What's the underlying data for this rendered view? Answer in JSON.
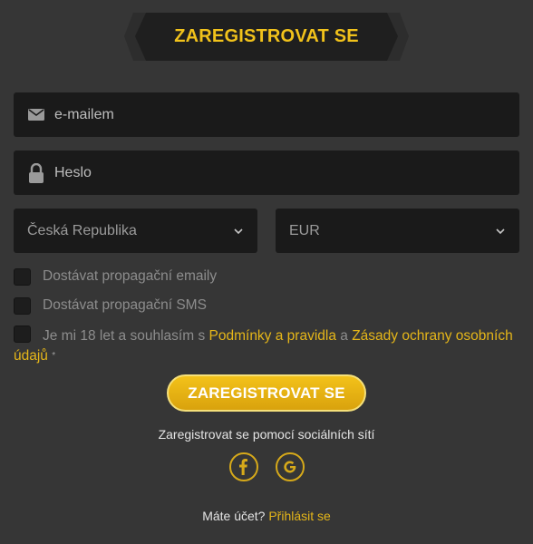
{
  "header": {
    "title": "ZAREGISTROVAT SE"
  },
  "form": {
    "email": {
      "placeholder": "e-mailem",
      "icon": "envelope-icon"
    },
    "password": {
      "placeholder": "Heslo",
      "icon": "lock-icon"
    },
    "country": {
      "value": "Česká Republika",
      "icon": "chevron-down-icon"
    },
    "currency": {
      "value": "EUR",
      "icon": "chevron-down-icon"
    }
  },
  "checkboxes": {
    "promo_emails": "Dostávat propagační emaily",
    "promo_sms": "Dostávat propagační SMS",
    "terms_prefix": "Je mi 18 let a souhlasím s",
    "terms_link": "Podmínky a pravidla",
    "terms_and": "a",
    "privacy_link": "Zásady ochrany osobních údajů",
    "required_mark": "*"
  },
  "register_button": "ZAREGISTROVAT SE",
  "social": {
    "label": "Zaregistrovat se pomocí sociálních sítí",
    "icons": [
      "facebook-icon",
      "google-icon"
    ]
  },
  "footer": {
    "question": "Máte účet?",
    "login_link": "Přihlásit se"
  },
  "colors": {
    "accent": "#f1c21b",
    "background": "#363636",
    "field": "#1a1a1a"
  }
}
